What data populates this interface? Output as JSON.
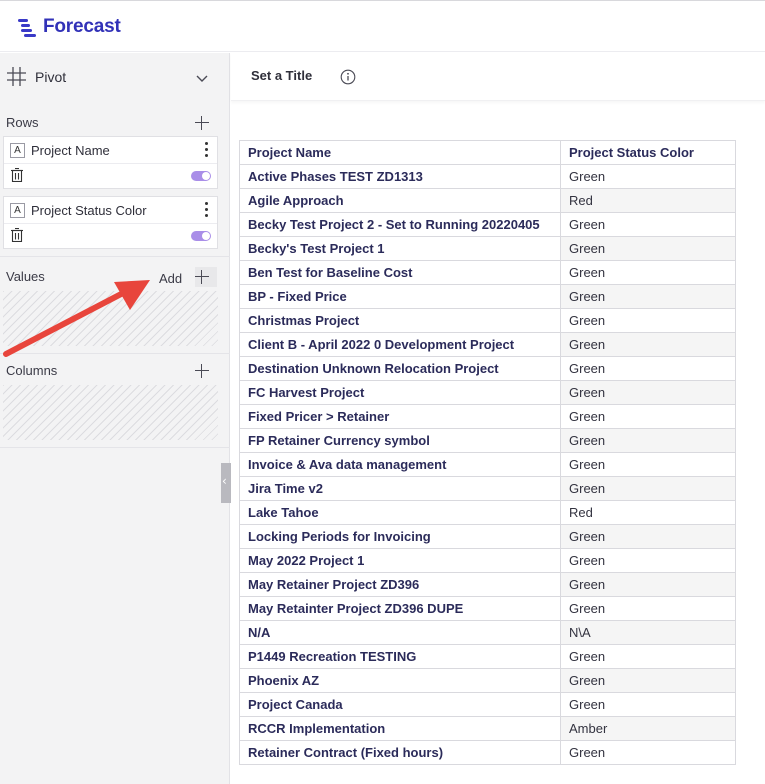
{
  "app": {
    "title": "Forecast"
  },
  "sidebar": {
    "mode_label": "Pivot",
    "rows": {
      "label": "Rows",
      "fields": [
        {
          "type": "A",
          "name": "Project Name"
        },
        {
          "type": "A",
          "name": "Project Status Color"
        }
      ]
    },
    "values": {
      "label": "Values",
      "add_label": "Add"
    },
    "columns": {
      "label": "Columns"
    }
  },
  "main": {
    "title_placeholder": "Set a Title",
    "table": {
      "headers": [
        "Project Name",
        "Project Status Color"
      ],
      "rows": [
        [
          "Active Phases TEST ZD1313",
          "Green"
        ],
        [
          "Agile Approach",
          "Red"
        ],
        [
          "Becky Test Project 2 - Set to Running 20220405",
          "Green"
        ],
        [
          "Becky's Test Project 1",
          "Green"
        ],
        [
          "Ben Test for Baseline Cost",
          "Green"
        ],
        [
          "BP - Fixed Price",
          "Green"
        ],
        [
          "Christmas Project",
          "Green"
        ],
        [
          "Client B - April 2022 0 Development Project",
          "Green"
        ],
        [
          "Destination Unknown Relocation Project",
          "Green"
        ],
        [
          "FC Harvest Project",
          "Green"
        ],
        [
          "Fixed Pricer > Retainer",
          "Green"
        ],
        [
          "FP Retainer Currency symbol",
          "Green"
        ],
        [
          "Invoice & Ava data management",
          "Green"
        ],
        [
          "Jira Time v2",
          "Green"
        ],
        [
          "Lake Tahoe",
          "Red"
        ],
        [
          "Locking Periods for Invoicing",
          "Green"
        ],
        [
          "May 2022 Project 1",
          "Green"
        ],
        [
          "May Retainer Project ZD396",
          "Green"
        ],
        [
          "May Retainter Project ZD396 DUPE",
          "Green"
        ],
        [
          "N/A",
          "N\\A"
        ],
        [
          "P1449 Recreation TESTING",
          "Green"
        ],
        [
          "Phoenix AZ",
          "Green"
        ],
        [
          "Project Canada",
          "Green"
        ],
        [
          "RCCR Implementation",
          "Amber"
        ],
        [
          "Retainer Contract (Fixed hours)",
          "Green"
        ]
      ]
    }
  },
  "colors": {
    "brand": "#3232b8",
    "toggle": "#a98ee8",
    "annotation_arrow": "#e8453c"
  }
}
